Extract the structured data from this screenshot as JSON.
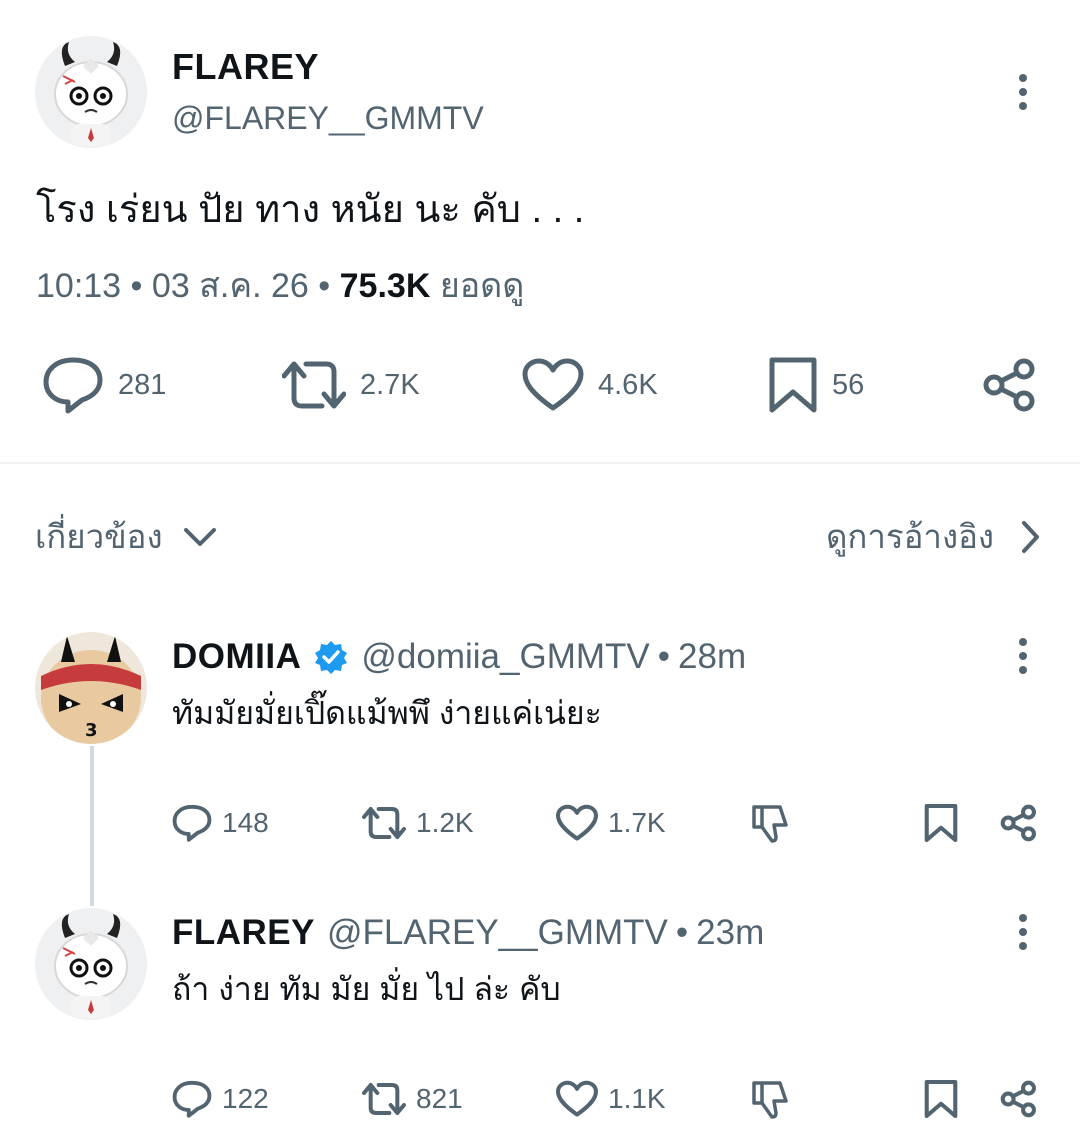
{
  "main_tweet": {
    "display_name": "FLAREY",
    "handle": "@FLAREY__GMMTV",
    "text": "โรง เร่ยน ปัย ทาง หนัย นะ คับ . . .",
    "time": "10:13",
    "date": "03 ส.ค. 26",
    "views_count": "75.3K",
    "views_label": "ยอดดู",
    "separator": "•",
    "replies": "281",
    "reposts": "2.7K",
    "likes": "4.6K",
    "bookmarks": "56"
  },
  "related": {
    "label": "เกี่ยวข้อง",
    "quotes_label": "ดูการอ้างอิง"
  },
  "replies": [
    {
      "display_name": "DOMIIA",
      "verified": true,
      "handle": "@domiia_GMMTV",
      "age": "28m",
      "text": "ทัมมัยมั่ยเปิ๊ดแม้พพึ ง่ายแค่เน่ยะ",
      "replies": "148",
      "reposts": "1.2K",
      "likes": "1.7K"
    },
    {
      "display_name": "FLAREY",
      "verified": false,
      "handle": "@FLAREY__GMMTV",
      "age": "23m",
      "text": "ถ้า ง่าย ทัม มัย มั่ย ไป ล่ะ คับ",
      "replies": "122",
      "reposts": "821",
      "likes": "1.1K"
    }
  ],
  "colors": {
    "text": "#0f1419",
    "muted": "#536471",
    "divider": "#eff3f4",
    "verified": "#1d9bf0",
    "thread_line": "#cfd9de"
  },
  "icons": [
    "more-icon",
    "reply-icon",
    "repost-icon",
    "like-icon",
    "bookmark-icon",
    "share-icon",
    "chevron-down-icon",
    "chevron-right-icon",
    "verified-badge-icon",
    "downvote-icon"
  ]
}
